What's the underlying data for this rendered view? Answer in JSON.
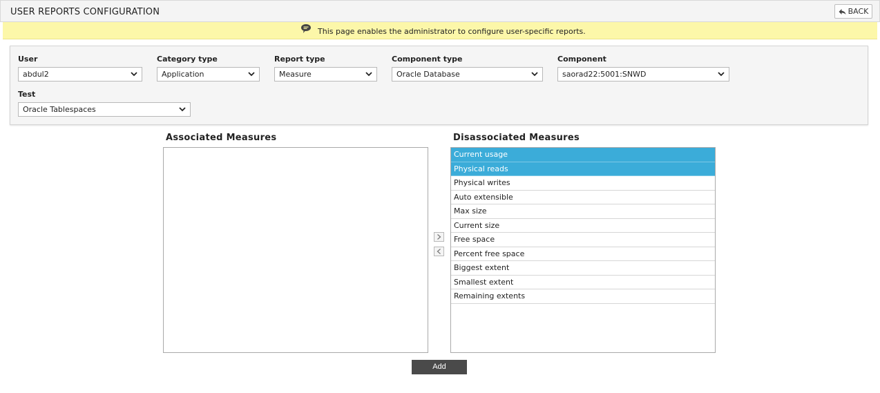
{
  "header": {
    "title": "USER REPORTS CONFIGURATION",
    "back_label": "BACK"
  },
  "info": {
    "message": "This page enables the administrator to configure user-specific reports."
  },
  "filters": {
    "user": {
      "label": "User",
      "value": "abdul2"
    },
    "category_type": {
      "label": "Category type",
      "value": "Application"
    },
    "report_type": {
      "label": "Report type",
      "value": "Measure"
    },
    "component_type": {
      "label": "Component type",
      "value": "Oracle Database"
    },
    "component": {
      "label": "Component",
      "value": "saorad22:5001:SNWD"
    },
    "test": {
      "label": "Test",
      "value": "Oracle Tablespaces"
    }
  },
  "associated": {
    "heading": "Associated Measures",
    "items": []
  },
  "disassociated": {
    "heading": "Disassociated Measures",
    "items": [
      {
        "label": "Current usage",
        "selected": true
      },
      {
        "label": "Physical reads",
        "selected": true
      },
      {
        "label": "Physical writes",
        "selected": false
      },
      {
        "label": "Auto extensible",
        "selected": false
      },
      {
        "label": "Max size",
        "selected": false
      },
      {
        "label": "Current size",
        "selected": false
      },
      {
        "label": "Free space",
        "selected": false
      },
      {
        "label": "Percent free space",
        "selected": false
      },
      {
        "label": "Biggest extent",
        "selected": false
      },
      {
        "label": "Smallest extent",
        "selected": false
      },
      {
        "label": "Remaining extents",
        "selected": false
      }
    ]
  },
  "actions": {
    "add_label": "Add"
  },
  "colors": {
    "selection": "#3bacd9",
    "info_background": "#fcf7a9",
    "add_button": "#4a4a4a"
  },
  "icons": {
    "back": "back-arrow-icon",
    "info": "speech-bubble-icon",
    "move_right": "chevron-right-icon",
    "move_left": "chevron-left-icon",
    "dropdown": "chevron-down-icon"
  }
}
